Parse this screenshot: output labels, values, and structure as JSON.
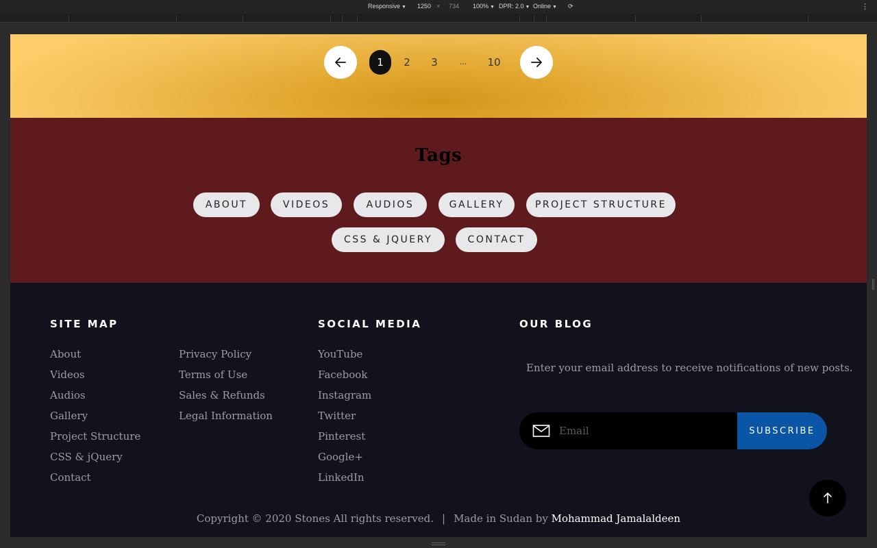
{
  "devtools": {
    "mode": "Responsive",
    "width": "1250",
    "times": "×",
    "height": "734",
    "zoom": "100%",
    "dpr": "DPR: 2.0",
    "network": "Online"
  },
  "pagination": {
    "pages": [
      "1",
      "2",
      "3",
      "...",
      "10"
    ],
    "current": "1"
  },
  "tags": {
    "title": "Tags",
    "items": [
      "ABOUT",
      "VIDEOS",
      "AUDIOS",
      "GALLERY",
      "PROJECT STRUCTURE",
      "CSS & JQUERY",
      "CONTACT"
    ]
  },
  "footer": {
    "sitemap": {
      "title": "SITE MAP",
      "col1": [
        "About",
        "Videos",
        "Audios",
        "Gallery",
        "Project Structure",
        "CSS & jQuery",
        "Contact"
      ],
      "col2": [
        "Privacy Policy",
        "Terms of Use",
        "Sales & Refunds",
        "Legal Information"
      ]
    },
    "social": {
      "title": "SOCIAL MEDIA",
      "links": [
        "YouTube",
        "Facebook",
        "Instagram",
        "Twitter",
        "Pinterest",
        "Google+",
        "LinkedIn"
      ]
    },
    "blog": {
      "title": "OUR BLOG",
      "text": "Enter your email address to receive notifications of new posts.",
      "email_placeholder": "Email",
      "subscribe_label": "SUBSCRIBE"
    },
    "copyright": {
      "text": "Copyright © 2020 Stones All rights reserved.",
      "separator": "|",
      "made_in": "Made in Sudan by",
      "author": "Mohammad Jamalaldeen"
    }
  },
  "colors": {
    "pager_band": "#e5ad38",
    "tags_band": "#5e1a1d",
    "footer_bg": "#11121b",
    "subscribe": "#0a55a6"
  },
  "icons": {
    "prev": "arrow-left-icon",
    "next": "arrow-right-icon",
    "mail": "envelope-icon",
    "top": "arrow-up-icon"
  }
}
